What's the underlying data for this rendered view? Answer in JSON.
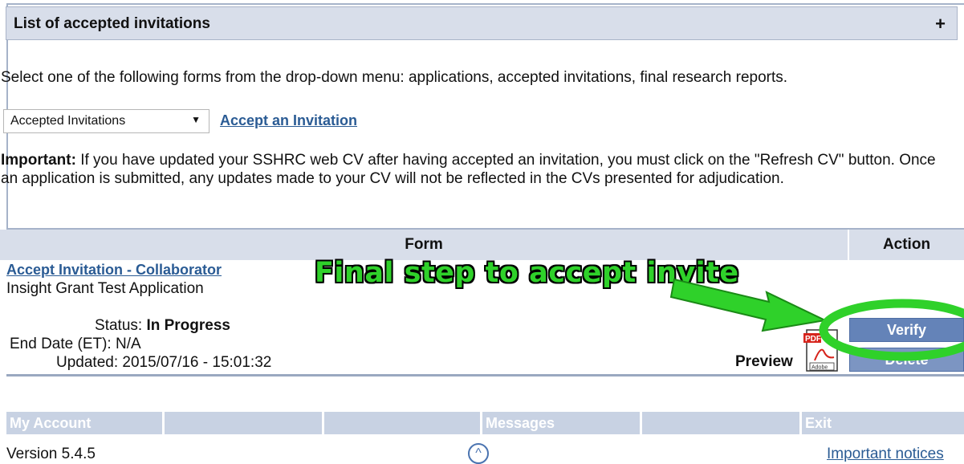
{
  "panel": {
    "title": "List of accepted invitations",
    "toggle": "+",
    "instruction": "Select one of the following forms from the drop-down menu: applications, accepted invitations, final research reports.",
    "select_value": "Accepted Invitations",
    "accept_link": "Accept an Invitation",
    "important_label": "Important:",
    "important_text": " If you have updated your SSHRC web CV after having accepted an invitation, you must click on the \"Refresh CV\" button. Once an application is submitted, any updates made to your CV will not be reflected in the CVs presented for adjudication."
  },
  "table": {
    "header_form": "Form",
    "header_action": "Action"
  },
  "row": {
    "link": "Accept Invitation - Collaborator",
    "title": "Insight Grant Test Application",
    "status_label": "Status:",
    "status_value": "In Progress",
    "end_label": "End Date (ET):",
    "end_value": "N/A",
    "updated_label": "Updated:",
    "updated_value": "2015/07/16 - 15:01:32",
    "preview_label": "Preview",
    "verify_label": "Verify",
    "delete_label": "Delete"
  },
  "annotation": {
    "text": "Final step to accept invite",
    "color": "#2fd12a"
  },
  "footer": {
    "nav": [
      "My Account",
      "",
      "",
      "Messages",
      "",
      "Exit"
    ],
    "version": "Version 5.4.5",
    "top_symbol": "^",
    "notices": "Important notices"
  }
}
